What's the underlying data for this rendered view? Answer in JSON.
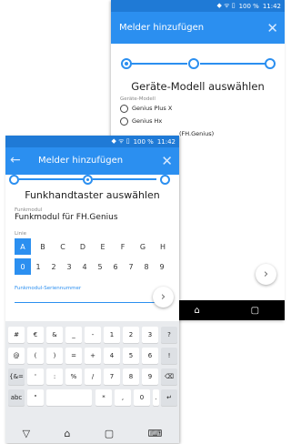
{
  "back_screen": {
    "status": {
      "battery_text": "100 %",
      "time": "11:42"
    },
    "title": "Melder hinzufügen",
    "heading": "Geräte-Modell auswählen",
    "model_label": "Geräte-Modell",
    "options": [
      "Genius Plus X",
      "Genius Hx",
      "(FH.Genius)"
    ],
    "fab_icon": "›"
  },
  "front_screen": {
    "status": {
      "battery_text": "100 %",
      "time": "11:42"
    },
    "title": "Melder hinzufügen",
    "heading": "Funkhandtaster auswählen",
    "module_label": "Funkmodul",
    "module_value": "Funkmodul für FH.Genius",
    "linie_label": "Linie",
    "letters": [
      "A",
      "B",
      "C",
      "D",
      "E",
      "F",
      "G",
      "H"
    ],
    "digits": [
      "0",
      "1",
      "2",
      "3",
      "4",
      "5",
      "6",
      "7",
      "8",
      "9"
    ],
    "serial_label": "Funkmodul-Seriennummer",
    "fab_icon": "›"
  },
  "keyboard": {
    "row1": [
      "#",
      "€",
      "&",
      "_",
      "-",
      "1",
      "2",
      "3",
      "?"
    ],
    "row2": [
      "@",
      "(",
      ")",
      "=",
      "+",
      "4",
      "5",
      "6",
      "!"
    ],
    "row3": [
      "{&=",
      "'",
      ":",
      "%",
      "/",
      "7",
      "8",
      "9",
      "⌫"
    ],
    "row4": [
      "abc",
      "\"",
      "*",
      ",",
      "0",
      ".",
      "↵"
    ]
  },
  "colors": {
    "primary": "#2b8ff0",
    "status": "#1f7ad6"
  }
}
